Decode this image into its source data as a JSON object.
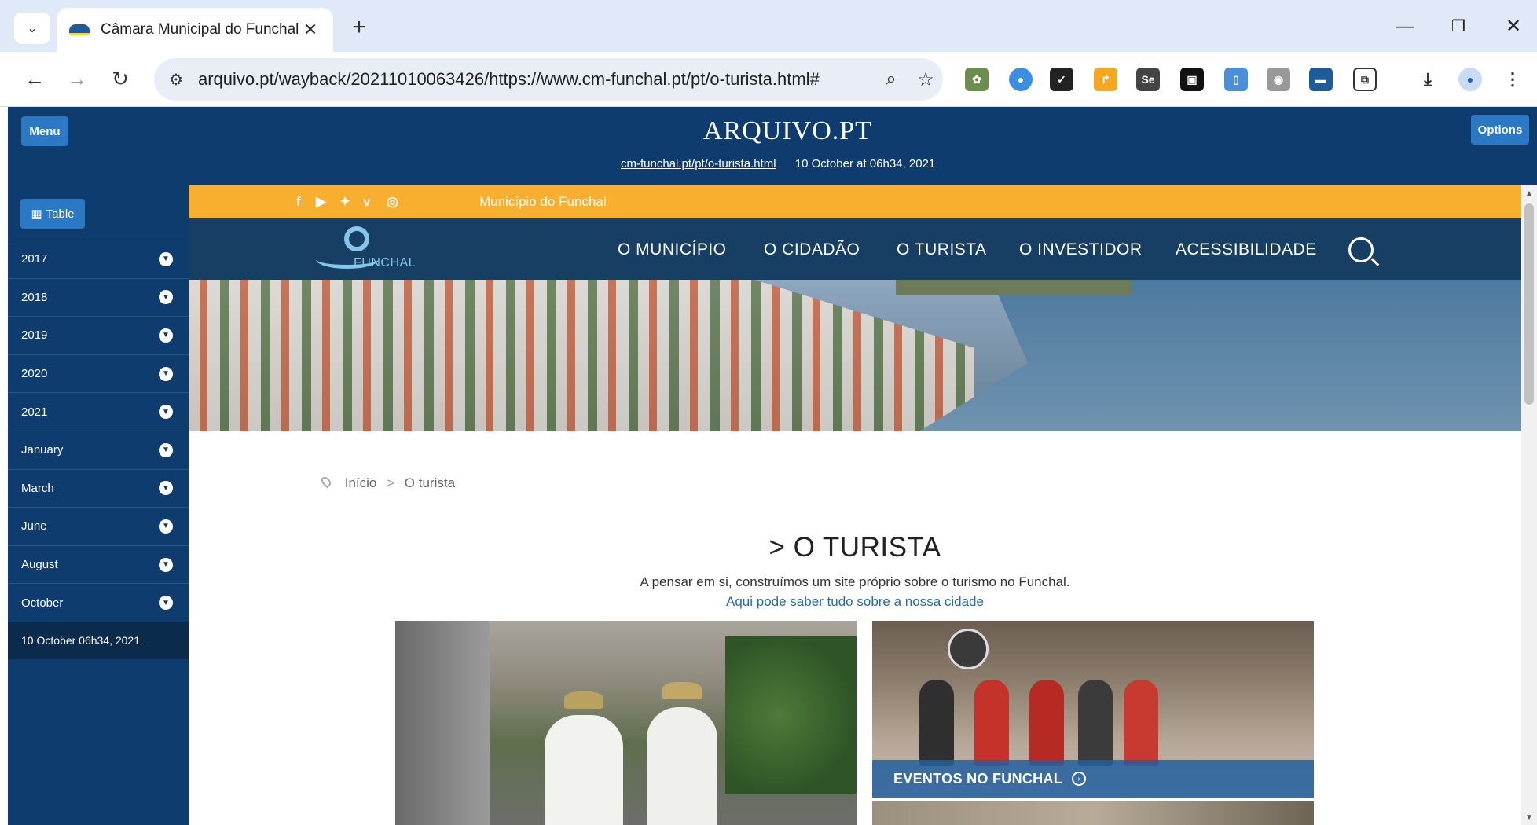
{
  "browser": {
    "tab_title": "Câmara Municipal do Funchal -",
    "url": "arquivo.pt/wayback/20211010063426/https://www.cm-funchal.pt/pt/o-turista.html#"
  },
  "arquivo": {
    "menu_label": "Menu",
    "options_label": "Options",
    "logo": "ARQUIVO.PT",
    "archived_url": "cm-funchal.pt/pt/o-turista.html",
    "archived_date": "10 October at 06h34, 2021",
    "table_label": "Table",
    "timeline": [
      "2017",
      "2018",
      "2019",
      "2020",
      "2021",
      "January",
      "March",
      "June",
      "August",
      "October"
    ],
    "current_version": "10 October 06h34, 2021"
  },
  "site": {
    "topbar_label": "Município do Funchal",
    "logo_text": "FUNCHAL",
    "nav": [
      "O MUNICÍPIO",
      "O CIDADÃO",
      "O TURISTA",
      "O INVESTIDOR",
      "ACESSIBILIDADE"
    ],
    "breadcrumb": {
      "home": "Início",
      "sep": ">",
      "current": "O turista"
    },
    "title": "> O TURISTA",
    "intro": "A pensar em si, construímos um site próprio sobre o turismo no Funchal.",
    "intro_link": "Aqui pode saber tudo sobre a nossa cidade",
    "events_label": "EVENTOS NO FUNCHAL"
  },
  "colors": {
    "arquivo_blue": "#0f3c6e",
    "button_blue": "#2b78c5",
    "topbar_orange": "#f8ae2e",
    "site_nav": "#173f64"
  }
}
